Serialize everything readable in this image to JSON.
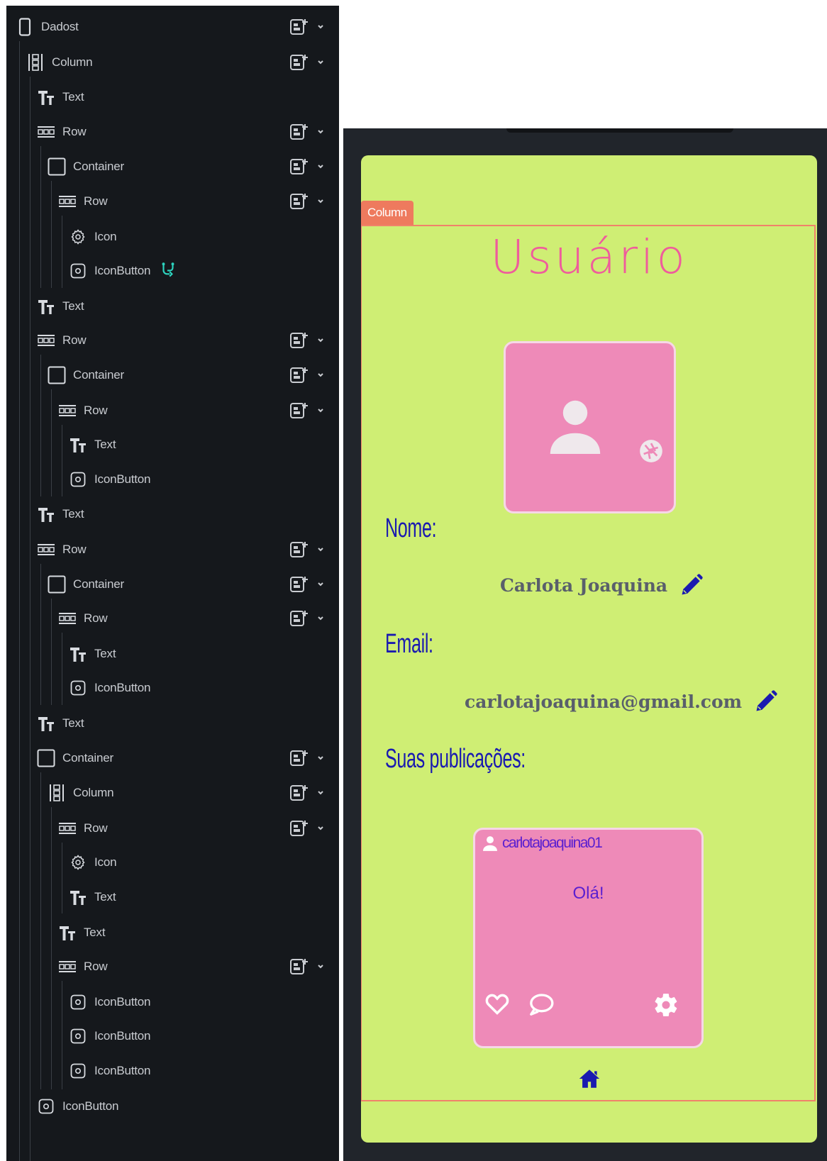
{
  "tree": {
    "nodes": [
      {
        "label": "Dadost",
        "icon": "phone-icon",
        "actions": true
      },
      {
        "label": "Column",
        "icon": "column-icon",
        "actions": true
      },
      {
        "label": "Text",
        "icon": "text-icon",
        "actions": false
      },
      {
        "label": "Row",
        "icon": "row-icon",
        "actions": true
      },
      {
        "label": "Container",
        "icon": "container-icon",
        "actions": true
      },
      {
        "label": "Row",
        "icon": "row-icon",
        "actions": true
      },
      {
        "label": "Icon",
        "icon": "gear-icon",
        "actions": false
      },
      {
        "label": "IconButton",
        "icon": "icon-button-icon",
        "actions": false,
        "has_action_flow": true
      },
      {
        "label": "Text",
        "icon": "text-icon",
        "actions": false
      },
      {
        "label": "Row",
        "icon": "row-icon",
        "actions": true
      },
      {
        "label": "Container",
        "icon": "container-icon",
        "actions": true
      },
      {
        "label": "Row",
        "icon": "row-icon",
        "actions": true
      },
      {
        "label": "Text",
        "icon": "text-icon",
        "actions": false
      },
      {
        "label": "IconButton",
        "icon": "icon-button-icon",
        "actions": false
      },
      {
        "label": "Text",
        "icon": "text-icon",
        "actions": false
      },
      {
        "label": "Row",
        "icon": "row-icon",
        "actions": true
      },
      {
        "label": "Container",
        "icon": "container-icon",
        "actions": true
      },
      {
        "label": "Row",
        "icon": "row-icon",
        "actions": true
      },
      {
        "label": "Text",
        "icon": "text-icon",
        "actions": false
      },
      {
        "label": "IconButton",
        "icon": "icon-button-icon",
        "actions": false
      },
      {
        "label": "Text",
        "icon": "text-icon",
        "actions": false
      },
      {
        "label": "Container",
        "icon": "container-icon",
        "actions": true
      },
      {
        "label": "Column",
        "icon": "column-icon",
        "actions": true
      },
      {
        "label": "Row",
        "icon": "row-icon",
        "actions": true
      },
      {
        "label": "Icon",
        "icon": "gear-icon",
        "actions": false
      },
      {
        "label": "Text",
        "icon": "text-icon",
        "actions": false
      },
      {
        "label": "Text",
        "icon": "text-icon",
        "actions": false
      },
      {
        "label": "Row",
        "icon": "row-icon",
        "actions": true
      },
      {
        "label": "IconButton",
        "icon": "icon-button-icon",
        "actions": false
      },
      {
        "label": "IconButton",
        "icon": "icon-button-icon",
        "actions": false
      },
      {
        "label": "IconButton",
        "icon": "icon-button-icon",
        "actions": false
      },
      {
        "label": "IconButton",
        "icon": "icon-button-icon",
        "actions": false
      }
    ]
  },
  "preview": {
    "column_tag": "Column",
    "title": "Usuário",
    "name_label": "Nome:",
    "name_value": "Carlota Joaquina",
    "email_label": "Email:",
    "email_value": "carlotajoaquina@gmail.com",
    "posts_label": "Suas publicações:",
    "post": {
      "username": "carlotajoaquina01",
      "text": "Olá!"
    }
  },
  "colors": {
    "screen_background": "#cfee74",
    "accent_pink": "#ee8ab8",
    "title_pink": "#ef5c9c",
    "label_blue": "#1a1ab0",
    "selection_outline": "#f0826a"
  }
}
